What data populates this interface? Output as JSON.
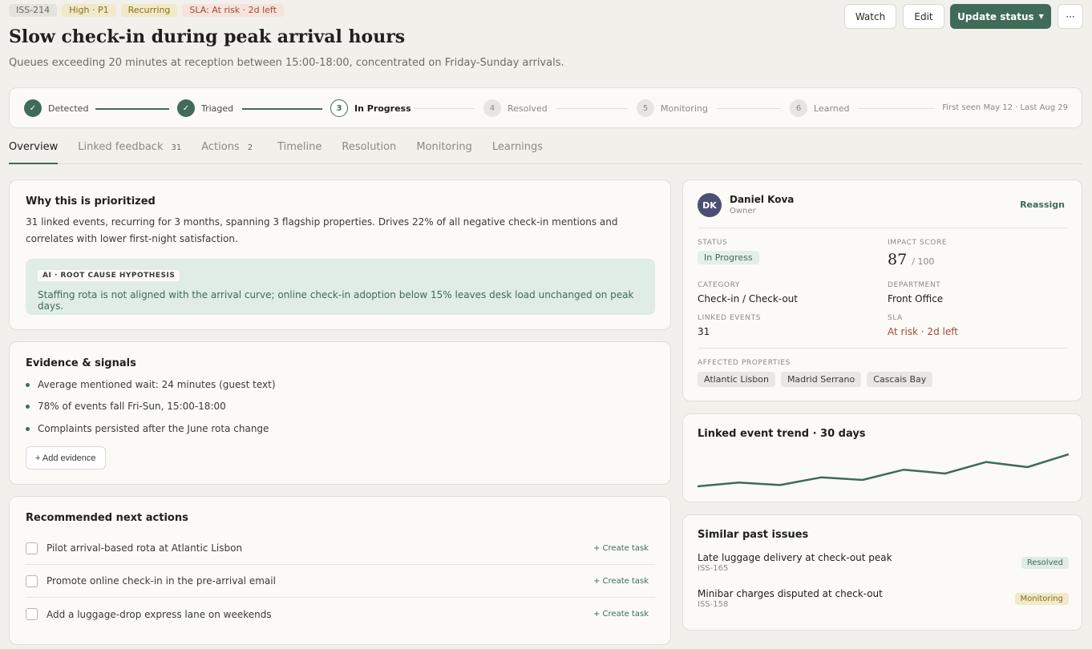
{
  "issue": {
    "id": "ISS-214",
    "priority": "High · P1",
    "recurring": "Recurring",
    "sla_tag": "SLA: At risk · 2d left",
    "title": "Slow check-in during peak arrival hours",
    "subtitle": "Queues exceeding 20 minutes at reception between 15:00-18:00, concentrated on Friday-Sunday arrivals."
  },
  "header_buttons": {
    "watch": "Watch",
    "edit": "Edit",
    "update_status": "Update status",
    "more": "···"
  },
  "stepper": {
    "steps": [
      {
        "num": "✓",
        "label": "Detected",
        "state": "done"
      },
      {
        "num": "✓",
        "label": "Triaged",
        "state": "done"
      },
      {
        "num": "3",
        "label": "In Progress",
        "state": "current"
      },
      {
        "num": "4",
        "label": "Resolved",
        "state": "todo"
      },
      {
        "num": "5",
        "label": "Monitoring",
        "state": "todo"
      },
      {
        "num": "6",
        "label": "Learned",
        "state": "todo"
      }
    ],
    "seen": "First seen May 12 · Last Aug 29"
  },
  "tabs": [
    {
      "label": "Overview",
      "count": ""
    },
    {
      "label": "Linked feedback",
      "count": "31"
    },
    {
      "label": "Actions",
      "count": "2"
    },
    {
      "label": "Timeline",
      "count": ""
    },
    {
      "label": "Resolution",
      "count": ""
    },
    {
      "label": "Monitoring",
      "count": ""
    },
    {
      "label": "Learnings",
      "count": ""
    }
  ],
  "why": {
    "title": "Why this is prioritized",
    "text": "31 linked events, recurring for 3 months, spanning 3 flagship properties. Drives 22% of all negative check-in mentions and correlates with lower first-night satisfaction.",
    "ai_label": "AI · ROOT CAUSE HYPOTHESIS",
    "ai_text": "Staffing rota is not aligned with the arrival curve; online check-in adoption below 15% leaves desk load unchanged on peak days."
  },
  "evidence": {
    "title": "Evidence & signals",
    "items": [
      "Average mentioned wait: 24 minutes (guest text)",
      "78% of events fall Fri-Sun, 15:00-18:00",
      "Complaints persisted after the June rota change"
    ],
    "add_label": "+ Add evidence"
  },
  "actions": {
    "title": "Recommended next actions",
    "create_label": "+ Create task",
    "items": [
      "Pilot arrival-based rota at Atlantic Lisbon",
      "Promote online check-in in the pre-arrival email",
      "Add a luggage-drop express lane on weekends"
    ]
  },
  "details": {
    "initials": "DK",
    "owner_name": "Daniel Kova",
    "owner_role": "Owner",
    "reassign": "Reassign",
    "status_label": "STATUS",
    "status_value": "In Progress",
    "impact_label": "IMPACT SCORE",
    "impact_value": "87",
    "impact_of": "/ 100",
    "category_label": "CATEGORY",
    "category_value": "Check-in / Check-out",
    "department_label": "DEPARTMENT",
    "department_value": "Front Office",
    "linked_label": "LINKED EVENTS",
    "linked_value": "31",
    "sla_label": "SLA",
    "sla_value": "At risk · 2d left",
    "props_label": "AFFECTED PROPERTIES",
    "properties": [
      "Atlantic Lisbon",
      "Madrid Serrano",
      "Cascais Bay"
    ]
  },
  "trend": {
    "title": "Linked event trend · 30 days",
    "values": [
      1,
      1.6,
      1.2,
      2.4,
      2,
      3.6,
      3,
      4.8,
      4,
      6
    ]
  },
  "similar": {
    "title": "Similar past issues",
    "items": [
      {
        "title": "Late luggage delivery at check-out peak",
        "id": "ISS-165",
        "status": "Resolved",
        "kind": "res"
      },
      {
        "title": "Minibar charges disputed at check-out",
        "id": "ISS-158",
        "status": "Monitoring",
        "kind": "mon"
      }
    ]
  },
  "colors": {
    "accent": "#3f6b58",
    "risk": "#a04a35",
    "background": "#f2f0eb"
  }
}
